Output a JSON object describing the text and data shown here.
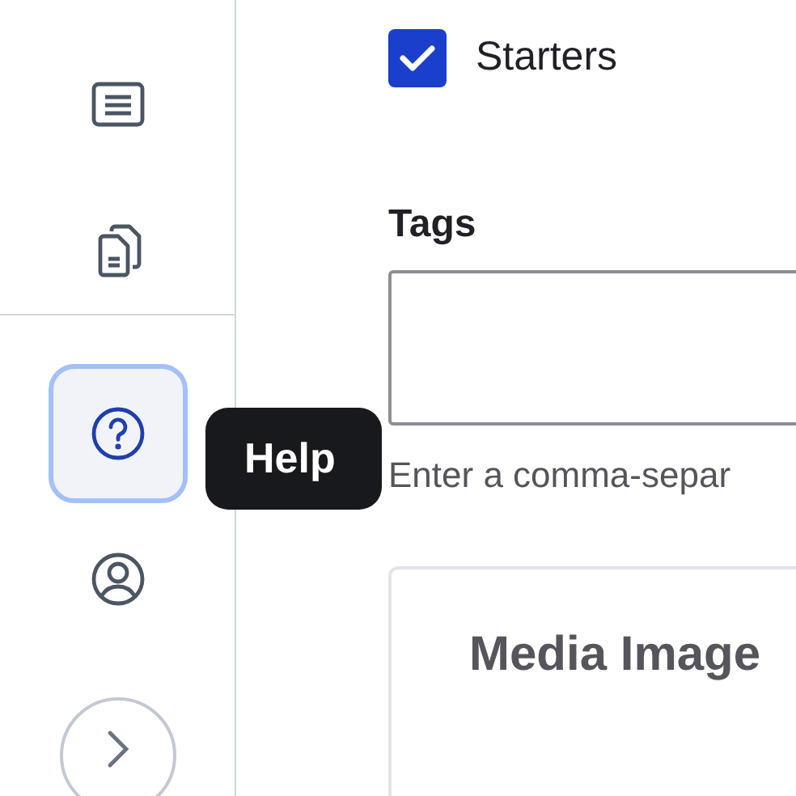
{
  "sidebar": {
    "top_items": [
      {
        "kind": "list",
        "selected": false
      },
      {
        "kind": "documents",
        "selected": false
      }
    ],
    "bottom_items": [
      {
        "kind": "help",
        "selected": true
      },
      {
        "kind": "user",
        "selected": false
      }
    ],
    "tooltip": "Help"
  },
  "checkbox": {
    "label": "Starters",
    "checked": true
  },
  "tags": {
    "label": "Tags",
    "help": "Enter a comma-separ"
  },
  "media_card": {
    "title": "Media Image"
  }
}
